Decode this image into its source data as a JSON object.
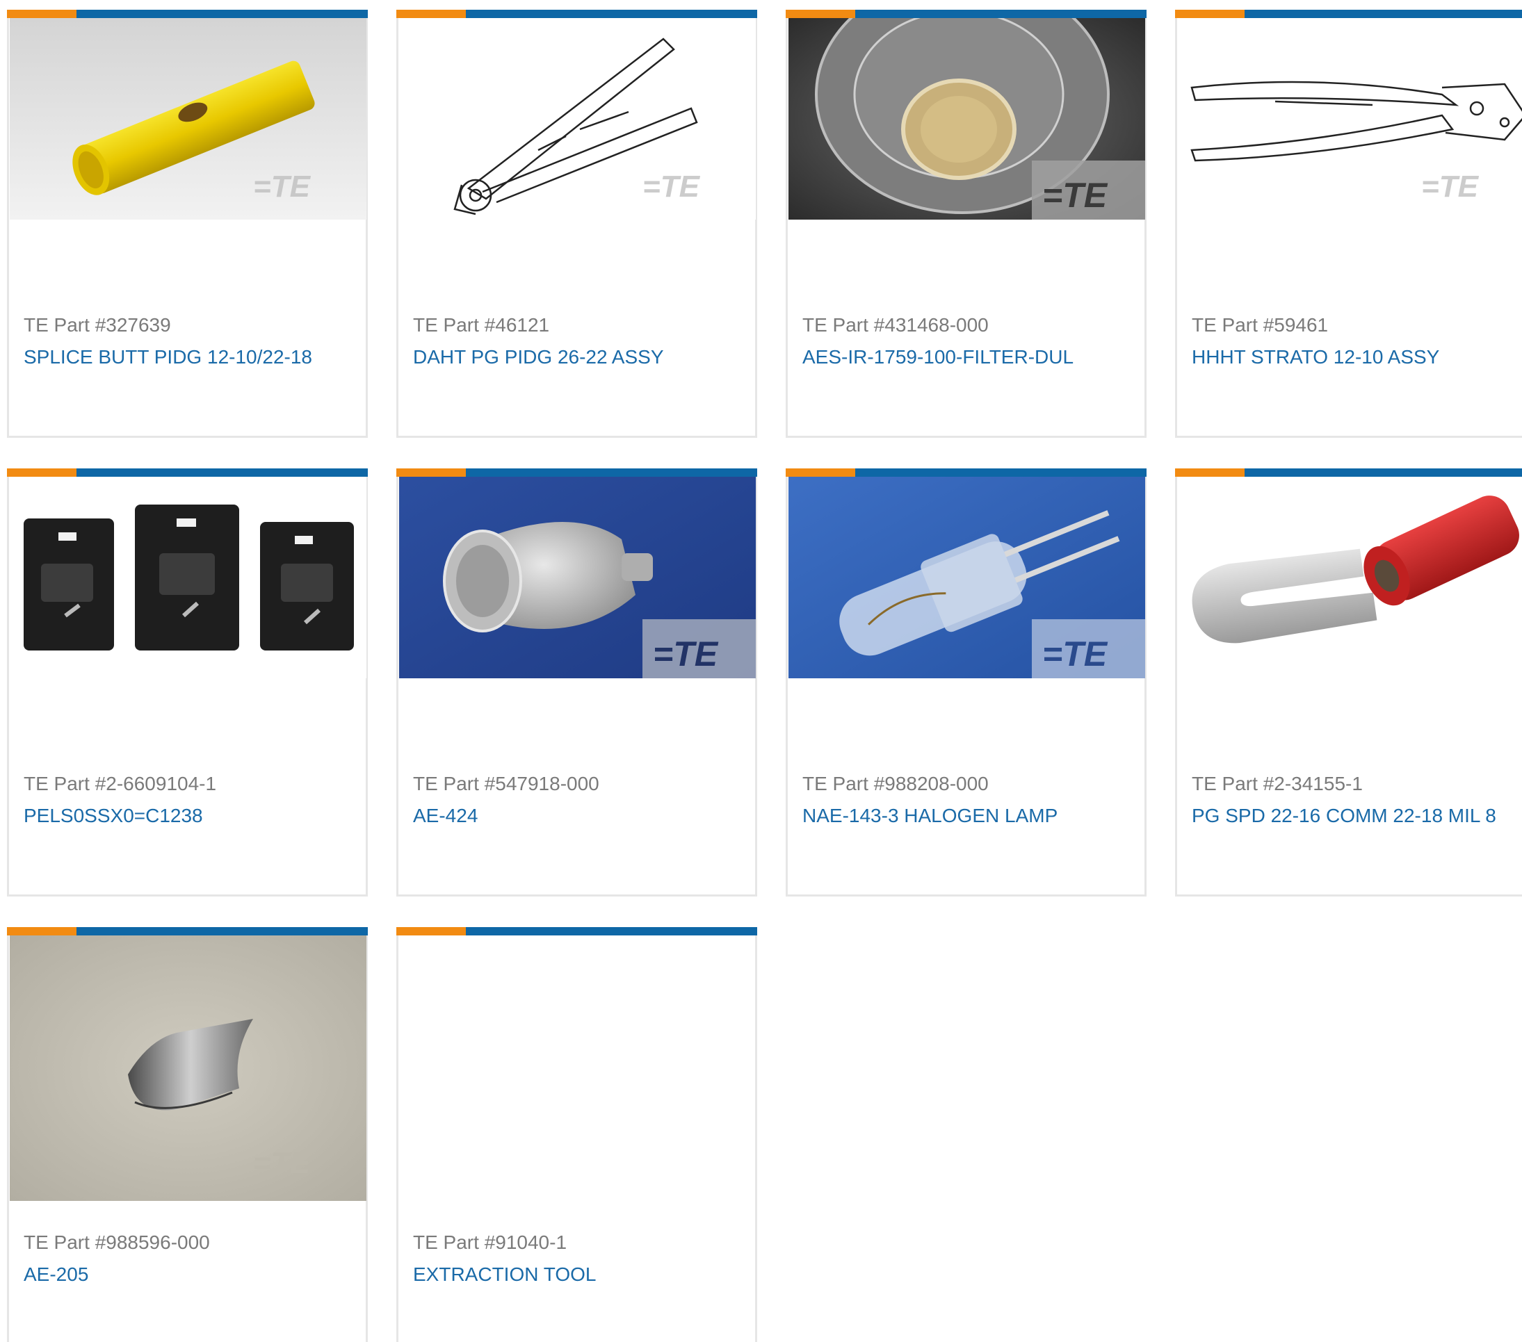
{
  "colors": {
    "accent_orange": "#f28b12",
    "accent_blue": "#0e67a6",
    "part_number_text": "#7a7a7a",
    "description_link": "#1a6aa8",
    "card_border": "#e6e6e6"
  },
  "watermark": "TE",
  "products": [
    {
      "part_number": "TE Part #327639",
      "description": "SPLICE BUTT PIDG 12-10/22-18",
      "image": "yellow-butt-splice-image"
    },
    {
      "part_number": "TE Part #46121",
      "description": "DAHT PG PIDG 26-22 ASSY",
      "image": "crimp-tool-drawing-image"
    },
    {
      "part_number": "TE Part #431468-000",
      "description": "AES-IR-1759-100-FILTER-DUL",
      "image": "glass-filter-image"
    },
    {
      "part_number": "TE Part #59461",
      "description": "HHHT STRATO 12-10 ASSY",
      "image": "hand-crimp-tool-drawing-image"
    },
    {
      "part_number": "TE Part #2-6609104-1",
      "description": "PELS0SSX0=C1238",
      "image": "power-entry-modules-image"
    },
    {
      "part_number": "TE Part #547918-000",
      "description": "AE-424",
      "image": "metal-cap-image"
    },
    {
      "part_number": "TE Part #988208-000",
      "description": "NAE-143-3 HALOGEN LAMP",
      "image": "halogen-lamp-image"
    },
    {
      "part_number": "TE Part #2-34155-1",
      "description": "PG SPD 22-16 COMM 22-18 MIL 8",
      "image": "red-spade-terminal-image"
    },
    {
      "part_number": "TE Part #988596-000",
      "description": "AE-205",
      "image": "curved-metal-shield-image"
    },
    {
      "part_number": "TE Part #91040-1",
      "description": "EXTRACTION TOOL",
      "image": "no-image"
    }
  ]
}
